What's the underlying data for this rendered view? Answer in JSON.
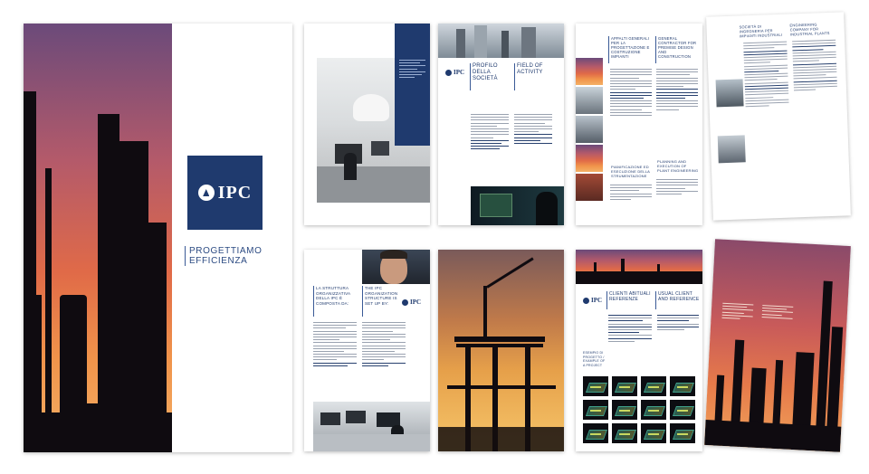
{
  "brand": {
    "name": "IPC",
    "navy": "#1f3a6e",
    "sunset_top": "#6b4a7a",
    "sunset_bottom": "#f4b066"
  },
  "cover": {
    "tagline_1": "PROGETTIAMO",
    "tagline_2": "EFFICIENZA"
  },
  "spread_profile": {
    "heading_it": "PROFILO DELLA SOCIETÀ",
    "heading_en": "FIELD OF ACTIVITY"
  },
  "spread_general": {
    "heading_it": "APPALTI GENERALI PER LA PROGETTAZIONE E COSTRUZIONE IMPIANTI",
    "heading_en": "GENERAL CONTRACTOR FOR PREMISE DESIGN AND CONSTRUCTION",
    "sub_it": "PIANIFICAZIONE ED ESECUZIONE DELLA STRUMENTAZIONE",
    "sub_en": "PLANNING AND EXECUTION OF PLANT ENGINEERING"
  },
  "spread_structure": {
    "heading_it": "LA STRUTTURA ORGANIZZATIVA DELLA IPC È COMPOSTA DA:",
    "heading_en": "THE IPC ORGANIZATION STRUCTURE IS SET UP BY:"
  },
  "spread_clients": {
    "heading_it": "CLIENTI ABITUALI REFERENZE",
    "heading_en": "USUAL CLIENT AND REFERENCE",
    "caption": "ESEMPIO DI PROGETTO / EXAMPLE OF A PROJECT"
  },
  "spread_insert": {
    "heading_it": "SOCIETÀ DI INGEGNERIA PER IMPIANTI INDUSTRIALI",
    "heading_en": "ENGINEERING COMPANY FOR INDUSTRIAL PLANTS"
  }
}
